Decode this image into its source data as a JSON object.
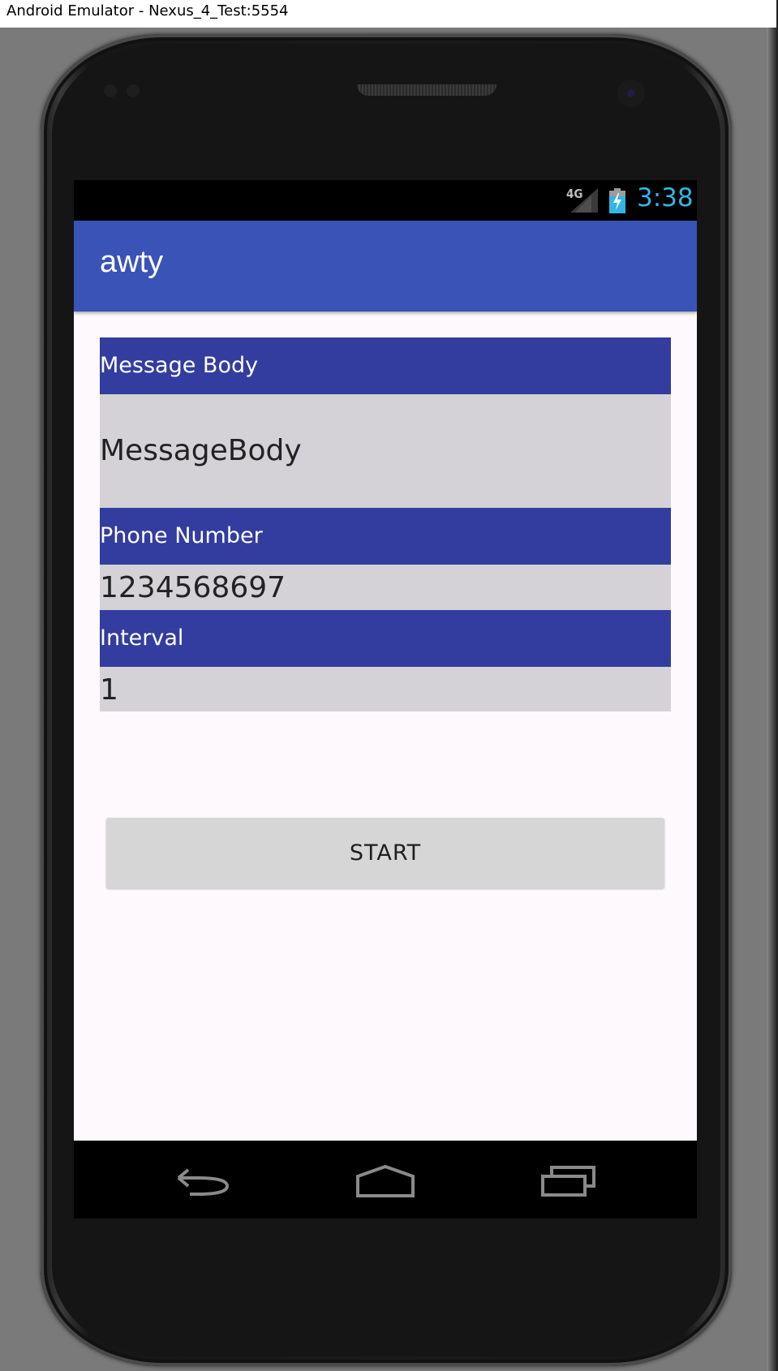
{
  "window": {
    "title": "Android Emulator - Nexus_4_Test:5554"
  },
  "status_bar": {
    "network_label": "4G",
    "time": "3:38",
    "icons": [
      "signal-icon",
      "battery-charging-icon"
    ],
    "time_color": "#33b5e5"
  },
  "app_bar": {
    "title": "awty",
    "color": "#3a53b7"
  },
  "form": {
    "message_body": {
      "label": "Message Body",
      "value": "MessageBody"
    },
    "phone_number": {
      "label": "Phone Number",
      "value": "1234568697"
    },
    "interval": {
      "label": "Interval",
      "value": "1"
    },
    "header_color": "#333d9f",
    "value_bg_color": "#d4d2d6"
  },
  "start_button": {
    "label": "START"
  },
  "nav_bar": {
    "icons": [
      "back-icon",
      "home-icon",
      "recents-icon"
    ]
  }
}
